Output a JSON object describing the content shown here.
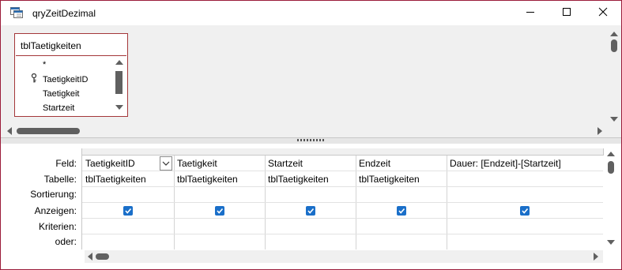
{
  "window": {
    "title": "qryZeitDezimal",
    "border_color": "#9b1c3a"
  },
  "table": {
    "name": "tblTaetigkeiten",
    "fields": [
      "*",
      "TaetigkeitID",
      "Taetigkeit",
      "Startzeit"
    ],
    "key_field": "TaetigkeitID"
  },
  "grid": {
    "row_labels": [
      "Feld:",
      "Tabelle:",
      "Sortierung:",
      "Anzeigen:",
      "Kriterien:",
      "oder:"
    ],
    "columns": [
      {
        "feld": "TaetigkeitID",
        "tabelle": "tblTaetigkeiten",
        "anzeigen": true,
        "has_dropdown": true
      },
      {
        "feld": "Taetigkeit",
        "tabelle": "tblTaetigkeiten",
        "anzeigen": true,
        "has_dropdown": false
      },
      {
        "feld": "Startzeit",
        "tabelle": "tblTaetigkeiten",
        "anzeigen": true,
        "has_dropdown": false
      },
      {
        "feld": "Endzeit",
        "tabelle": "tblTaetigkeiten",
        "anzeigen": true,
        "has_dropdown": false
      },
      {
        "feld": "Dauer: [Endzeit]-[Startzeit]",
        "tabelle": "",
        "anzeigen": true,
        "has_dropdown": false
      }
    ]
  },
  "colors": {
    "checkbox": "#1a6fc9",
    "table_border": "#a4373a"
  }
}
